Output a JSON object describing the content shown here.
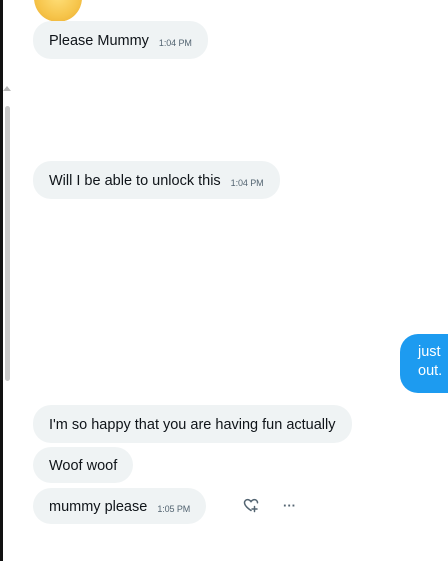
{
  "conversation": {
    "incoming": [
      {
        "text": "Please Mummy",
        "time": "1:04 PM"
      },
      {
        "text": "Will I be able to unlock this",
        "time": "1:04 PM"
      },
      {
        "text": "I'm so happy that you are having fun actually",
        "time": ""
      },
      {
        "text": "Woof woof",
        "time": ""
      },
      {
        "text": "mummy please",
        "time": "1:05 PM"
      }
    ],
    "outgoing": {
      "line1": "just",
      "line2": "out."
    }
  },
  "actions": {
    "react_icon": "heart-plus-icon",
    "more_icon": "more-icon",
    "more_glyph": "···"
  },
  "colors": {
    "incoming_bg": "#eff3f4",
    "outgoing_bg": "#1d9bf0",
    "text": "#0f1419",
    "muted": "#536471"
  }
}
